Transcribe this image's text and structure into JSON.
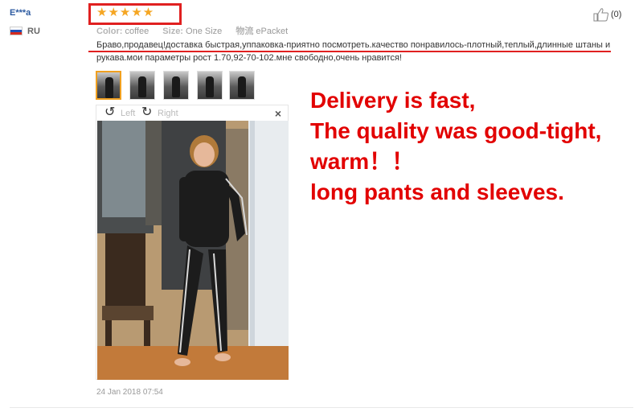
{
  "reviewer": {
    "name": "E***a",
    "country": "RU"
  },
  "rating": {
    "stars": 5,
    "max": 5,
    "stars_text": "★★★★★"
  },
  "likes": {
    "count": "(0)"
  },
  "attributes": [
    {
      "key": "Color:",
      "value": "coffee"
    },
    {
      "key": "Size:",
      "value": "One Size"
    },
    {
      "key": "物流",
      "value": "ePacket"
    }
  ],
  "review": {
    "text": "Браво,продавец!доставка быстрая,уппаковка-приятно посмотреть.качество понравилось-плотный,теплый,длинные штаны и рукава.мои параметры рост 1.70,92-70-102.мне свободно,очень нравится!"
  },
  "viewer": {
    "rotate_left_label": "Left",
    "rotate_right_label": "Right",
    "close_label": "×",
    "active_thumbnail": 1,
    "thumbnail_count": 5
  },
  "date": "24 Jan 2018 07:54",
  "annotation": {
    "lines": [
      "Delivery is fast,",
      "The quality was good-tight,",
      "warm！！",
      "long pants and sleeves."
    ]
  },
  "colors": {
    "accent_red": "#e02020",
    "star": "#f5a623",
    "name_link": "#2c5aa0"
  }
}
